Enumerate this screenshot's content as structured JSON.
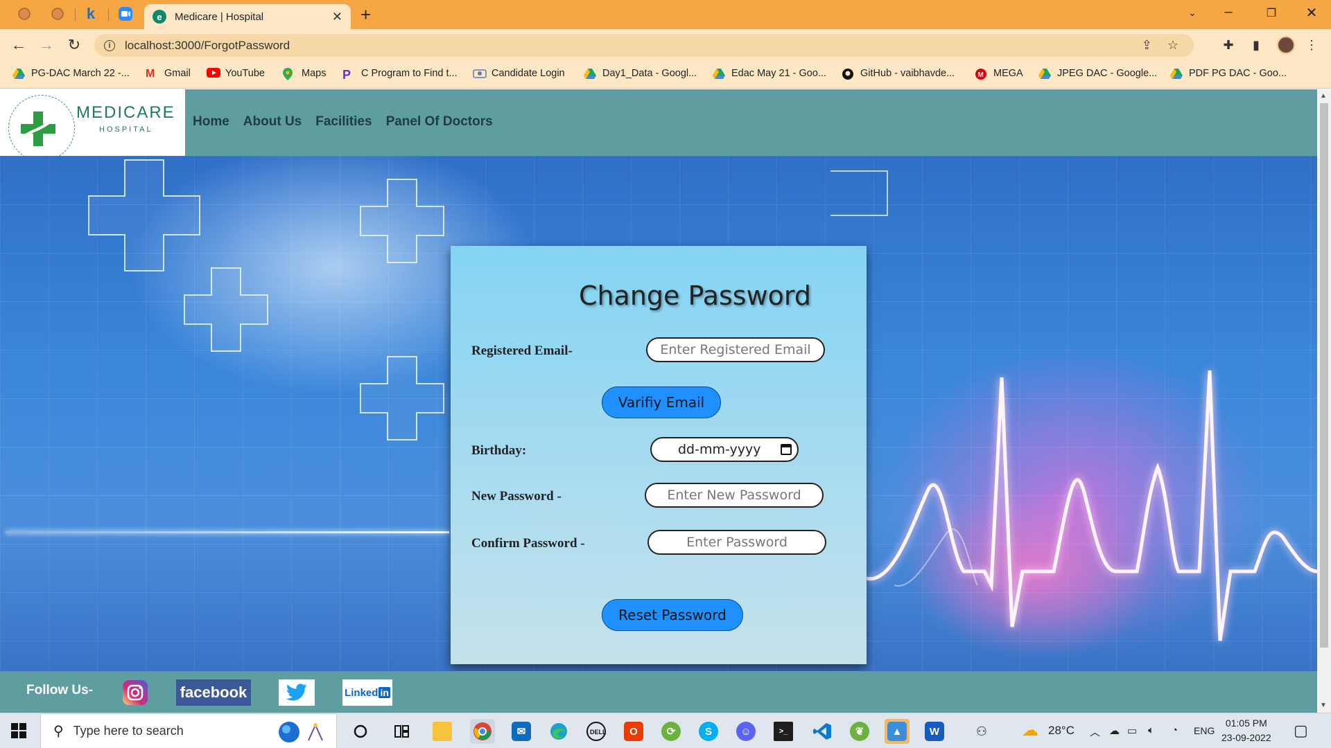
{
  "browser": {
    "active_tab_title": "Medicare | Hospital",
    "favicon_letter": "e",
    "url": "localhost:3000/ForgotPassword",
    "bookmarks": [
      {
        "label": "PG-DAC March 22 -...",
        "icon": "google-drive-icon",
        "color": "#1da462"
      },
      {
        "label": "Gmail",
        "icon": "gmail-icon",
        "color": "#d93025"
      },
      {
        "label": "YouTube",
        "icon": "youtube-icon",
        "color": "#ff0000"
      },
      {
        "label": "Maps",
        "icon": "maps-icon",
        "color": "#34a853"
      },
      {
        "label": "C Program to Find t...",
        "icon": "programiz-icon",
        "color": "#6c2bd9"
      },
      {
        "label": "Candidate Login",
        "icon": "candidate-login-icon",
        "color": "#5b7db8"
      },
      {
        "label": "Day1_Data - Googl...",
        "icon": "google-drive-icon",
        "color": "#1da462"
      },
      {
        "label": "Edac May 21 - Goo...",
        "icon": "google-drive-icon",
        "color": "#1da462"
      },
      {
        "label": "GitHub - vaibhavde...",
        "icon": "github-icon",
        "color": "#111111"
      },
      {
        "label": "MEGA",
        "icon": "mega-icon",
        "color": "#d90007"
      },
      {
        "label": "JPEG DAC - Google...",
        "icon": "google-drive-icon",
        "color": "#1da462"
      },
      {
        "label": "PDF PG DAC - Goo...",
        "icon": "google-drive-icon",
        "color": "#1da462"
      }
    ]
  },
  "site": {
    "logo_title": "MEDICARE",
    "logo_subtitle": "HOSPITAL",
    "nav": [
      "Home",
      "About Us",
      "Facilities",
      "Panel Of Doctors"
    ]
  },
  "form": {
    "title": "Change Password",
    "email_label": "Registered Email-",
    "email_placeholder": "Enter Registered Email",
    "verify_button": "Varifiy Email",
    "birthday_label": "Birthday:",
    "birthday_placeholder": "dd-mm-yyyy",
    "new_password_label": "New Password -",
    "new_password_placeholder": "Enter New Password",
    "confirm_password_label": "Confirm Password -",
    "confirm_password_placeholder": "Enter Password",
    "reset_button": "Reset Password"
  },
  "footer": {
    "follow_label": "Follow Us-",
    "facebook": "facebook",
    "linkedin": "Linked"
  },
  "taskbar": {
    "search_placeholder": "Type here to search",
    "weather": "28°C",
    "language": "ENG",
    "time": "01:05 PM",
    "date": "23-09-2022"
  },
  "colors": {
    "tabbar": "#f7a644",
    "navbar": "#5f9ea0",
    "button": "#1e90ff",
    "card_top": "#84d4f4"
  }
}
